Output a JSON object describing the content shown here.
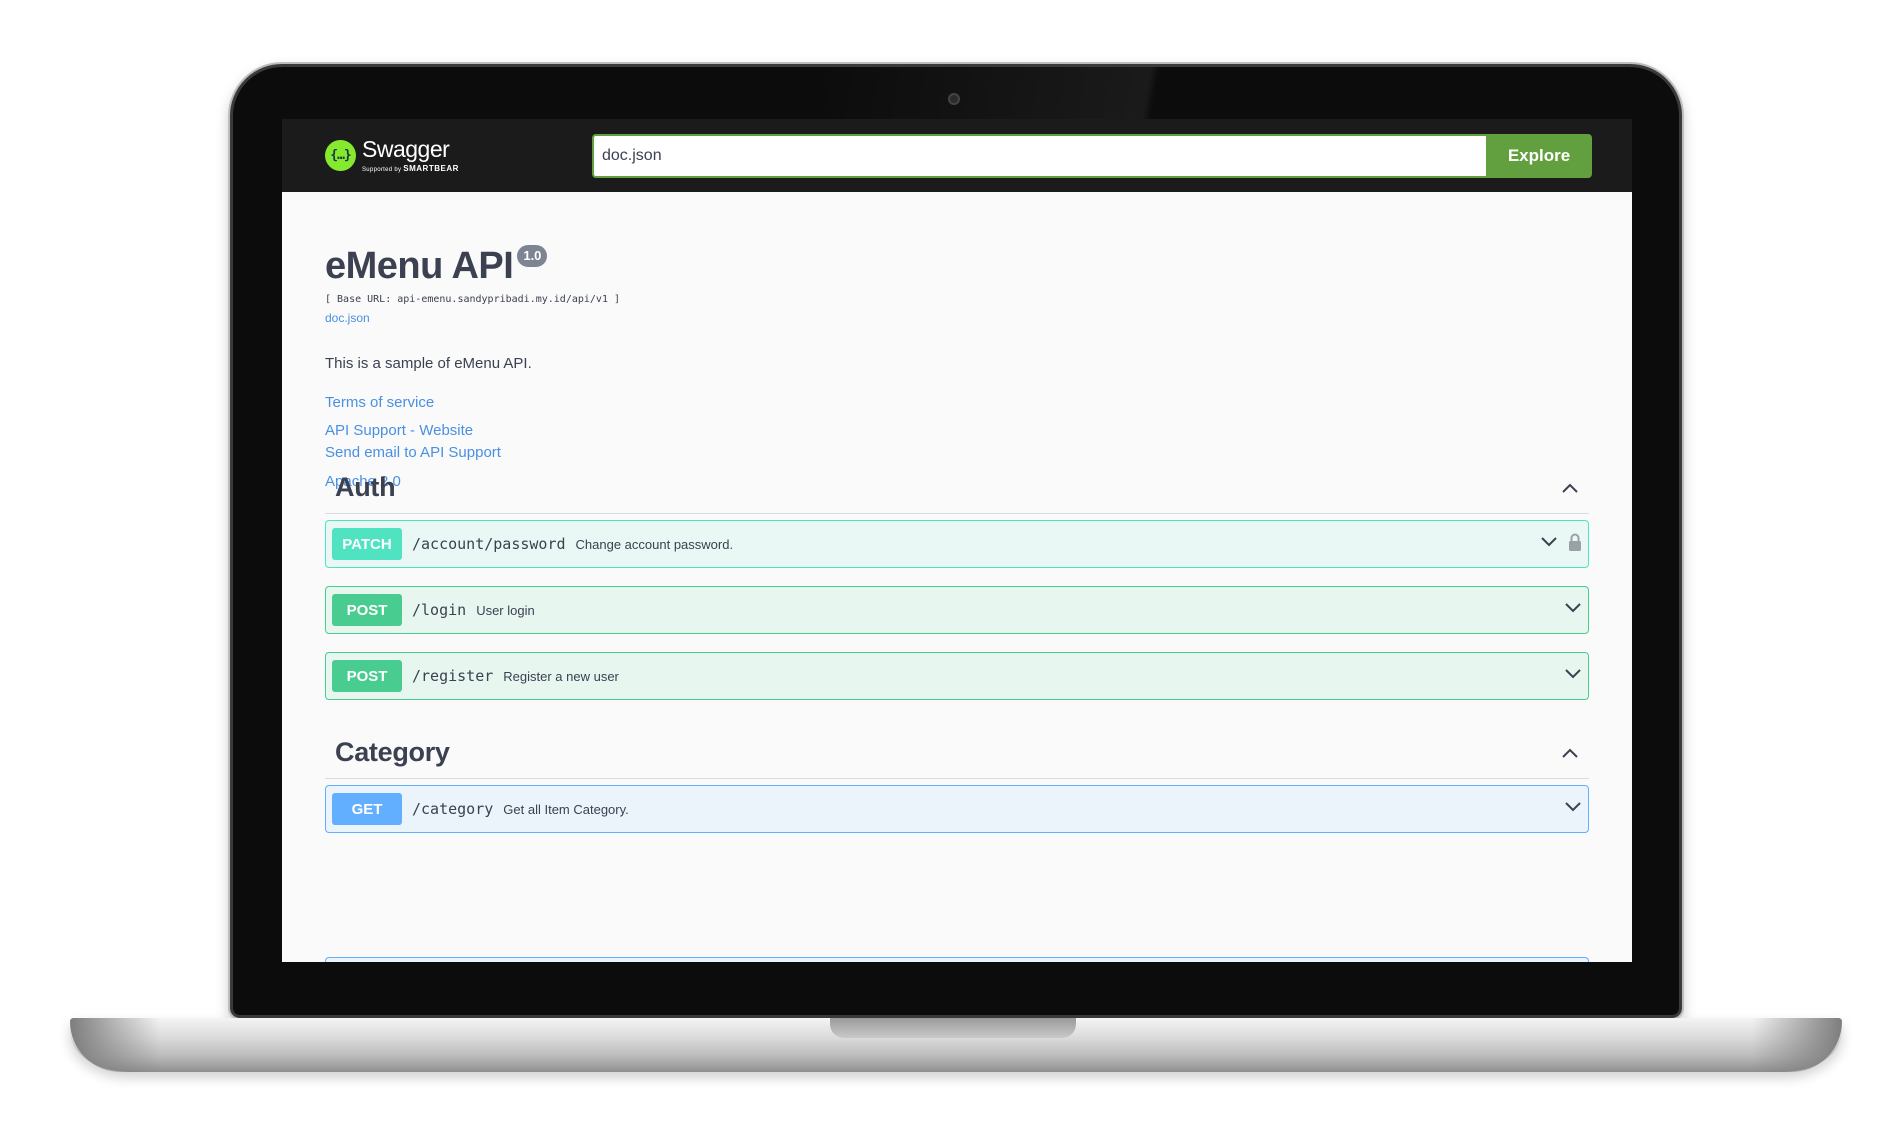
{
  "topbar": {
    "logo": {
      "glyph": "{…}",
      "name": "Swagger",
      "supported_by": "Supported by",
      "brand": "SMARTBEAR"
    },
    "url_input": {
      "value": "doc.json"
    },
    "explore_label": "Explore",
    "colors": {
      "bar": "#1b1b1b",
      "accent": "#62a03f",
      "logo": "#85ea2d"
    }
  },
  "info": {
    "title": "eMenu API",
    "version": "1.0",
    "base_url": "[ Base URL: api-emenu.sandypribadi.my.id/api/v1 ]",
    "doc_link": "doc.json",
    "description": "This is a sample of eMenu API.",
    "links": {
      "terms": "Terms of service",
      "support": "API Support - Website",
      "email": "Send email to API Support",
      "license": "Apache 2.0"
    }
  },
  "tags": [
    {
      "name": "Auth",
      "operations": [
        {
          "method": "PATCH",
          "path": "/account/password",
          "summary": "Change account password.",
          "locked": true
        },
        {
          "method": "POST",
          "path": "/login",
          "summary": "User login",
          "locked": false
        },
        {
          "method": "POST",
          "path": "/register",
          "summary": "Register a new user",
          "locked": false
        }
      ]
    },
    {
      "name": "Category",
      "operations": [
        {
          "method": "GET",
          "path": "/category",
          "summary": "Get all Item Category.",
          "locked": false
        }
      ]
    }
  ],
  "method_colors": {
    "PATCH": "#50e3c2",
    "POST": "#49cc90",
    "GET": "#61affe"
  },
  "icons": {
    "collapse": "chevron-up-icon",
    "expand": "chevron-down-icon",
    "lock": "lock-icon"
  }
}
